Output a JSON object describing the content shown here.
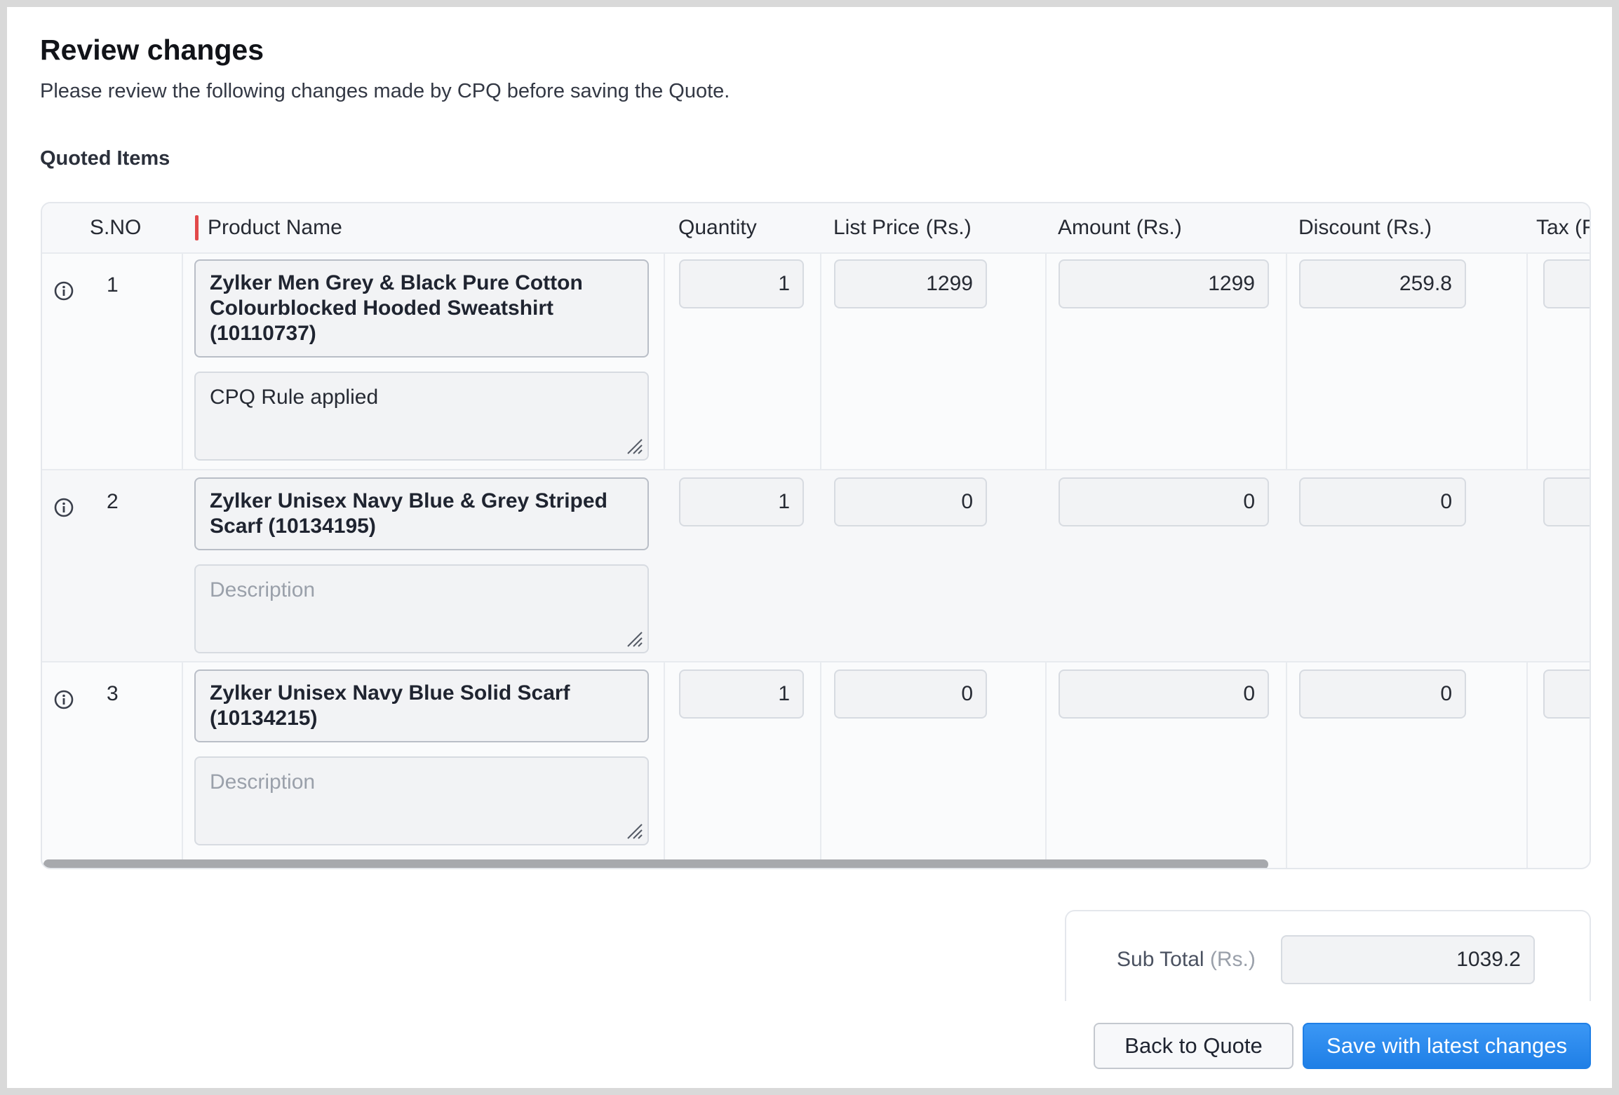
{
  "header": {
    "title": "Review changes",
    "subtitle": "Please review the following changes made by CPQ before saving the Quote."
  },
  "section": {
    "title": "Quoted Items"
  },
  "table": {
    "columns": [
      "S.NO",
      "Product Name",
      "Quantity",
      "List Price (Rs.)",
      "Amount (Rs.)",
      "Discount (Rs.)",
      "Tax (R"
    ],
    "rows": [
      {
        "sno": "1",
        "product": "Zylker Men Grey & Black Pure Cotton Colourblocked Hooded Sweatshirt (10110737)",
        "description": "CPQ Rule applied",
        "quantity": "1",
        "list_price": "1299",
        "amount": "1299",
        "discount": "259.8"
      },
      {
        "sno": "2",
        "product": "Zylker Unisex Navy Blue & Grey Striped Scarf (10134195)",
        "description_placeholder": "Description",
        "quantity": "1",
        "list_price": "0",
        "amount": "0",
        "discount": "0"
      },
      {
        "sno": "3",
        "product": "Zylker Unisex Navy Blue Solid Scarf (10134215)",
        "description_placeholder": "Description",
        "quantity": "1",
        "list_price": "0",
        "amount": "0",
        "discount": "0"
      }
    ]
  },
  "summary": {
    "subtotal_label": "Sub Total",
    "subtotal_unit": "(Rs.)",
    "subtotal_value": "1039.2"
  },
  "buttons": {
    "back": "Back to Quote",
    "save": "Save with latest changes"
  },
  "colors": {
    "required_marker": "#e2494a",
    "primary": "#1f7fe6"
  },
  "icons": {
    "row_info": "info-circle-icon",
    "resize": "resize-grip-icon"
  }
}
